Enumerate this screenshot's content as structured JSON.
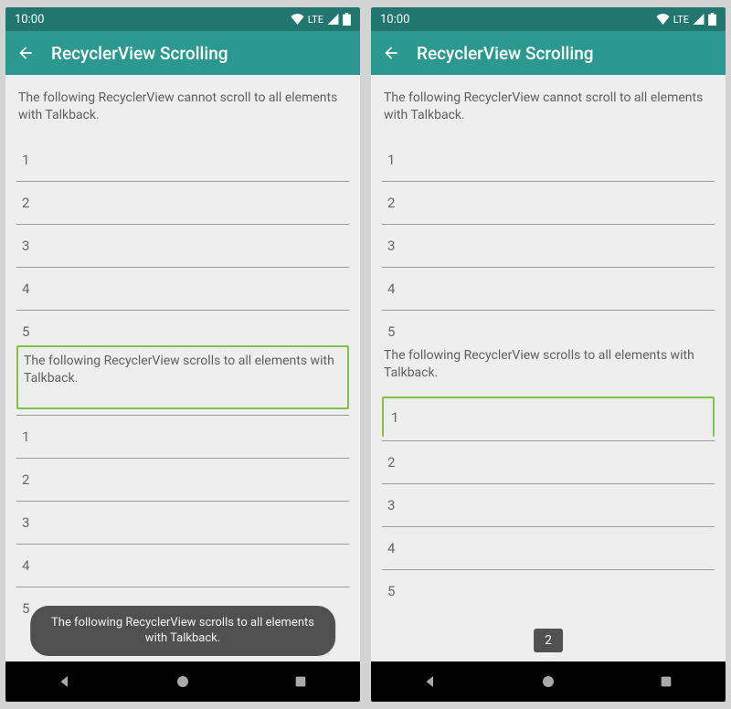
{
  "status": {
    "time": "10:00",
    "network": "LTE"
  },
  "appbar": {
    "title": "RecyclerView Scrolling"
  },
  "section1_text": "The following RecyclerView cannot scroll to all elements with Talkback.",
  "section2_text": "The following RecyclerView scrolls to all elements with Talkback.",
  "items": {
    "i1": "1",
    "i2": "2",
    "i3": "3",
    "i4": "4",
    "i5": "5"
  },
  "toast": {
    "left": "The following RecyclerView scrolls to all elements with Talkback.",
    "right": "2"
  }
}
